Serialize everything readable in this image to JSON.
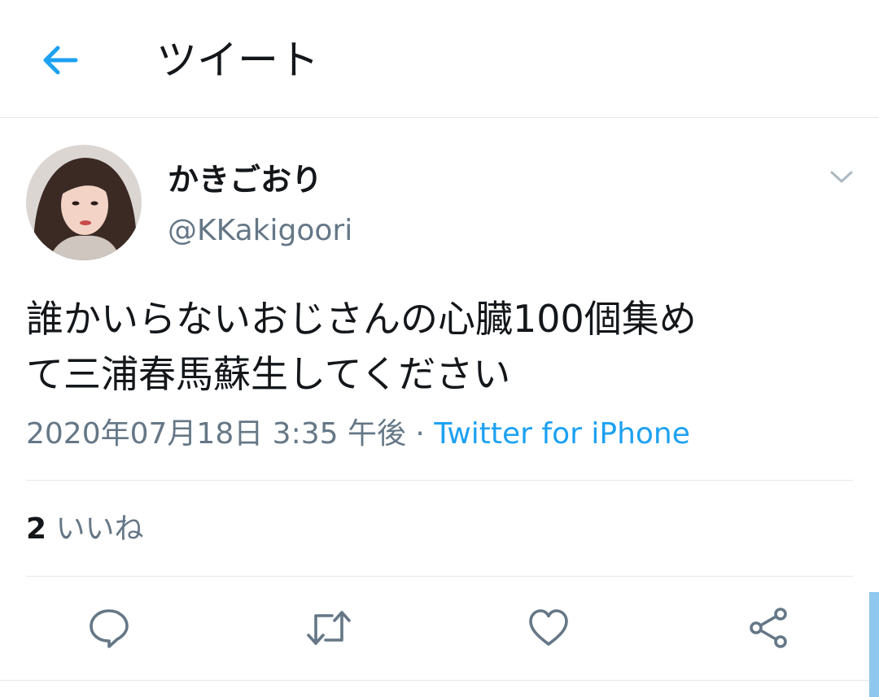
{
  "header": {
    "title": "ツイート"
  },
  "tweet": {
    "display_name": "かきごおり",
    "handle": "@KKakigoori",
    "text_line1": "誰かいらないおじさんの心臓100個集め",
    "text_line2": "て三浦春馬蘇生してください",
    "timestamp": "2020年07月18日 3:35 午後",
    "separator": "·",
    "source": "Twitter for iPhone",
    "likes_count": "2",
    "likes_label": "いいね"
  },
  "colors": {
    "accent": "#1da1f2",
    "text": "#14171a",
    "muted": "#657786",
    "divider": "#e1e8ed"
  },
  "icons": [
    "back-arrow-icon",
    "chevron-down-icon",
    "reply-icon",
    "retweet-icon",
    "like-icon",
    "share-icon"
  ]
}
